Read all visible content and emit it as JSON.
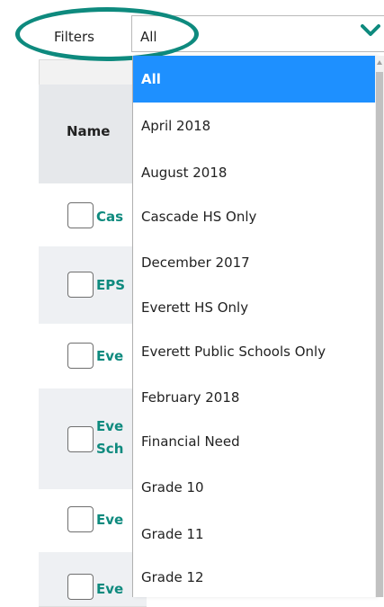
{
  "filter": {
    "label": "Filters",
    "selected": "All"
  },
  "table": {
    "name_header": "Name",
    "rows": [
      {
        "text": "Cas"
      },
      {
        "text": "EPS"
      },
      {
        "text": "Eve"
      },
      {
        "text": "Eve",
        "text2": "Sch"
      },
      {
        "text": "Eve"
      },
      {
        "text": "Eve"
      }
    ]
  },
  "dropdown": {
    "options": [
      "All",
      "April 2018",
      "August 2018",
      "Cascade HS Only",
      "December 2017",
      "Everett HS Only",
      "Everett Public Schools Only",
      "February 2018",
      "Financial Need",
      "Grade 10",
      "Grade 11",
      "Grade 12"
    ],
    "selected_index": 0
  },
  "colors": {
    "accent": "#0e8a7e",
    "selected_bg": "#1e90ff"
  }
}
